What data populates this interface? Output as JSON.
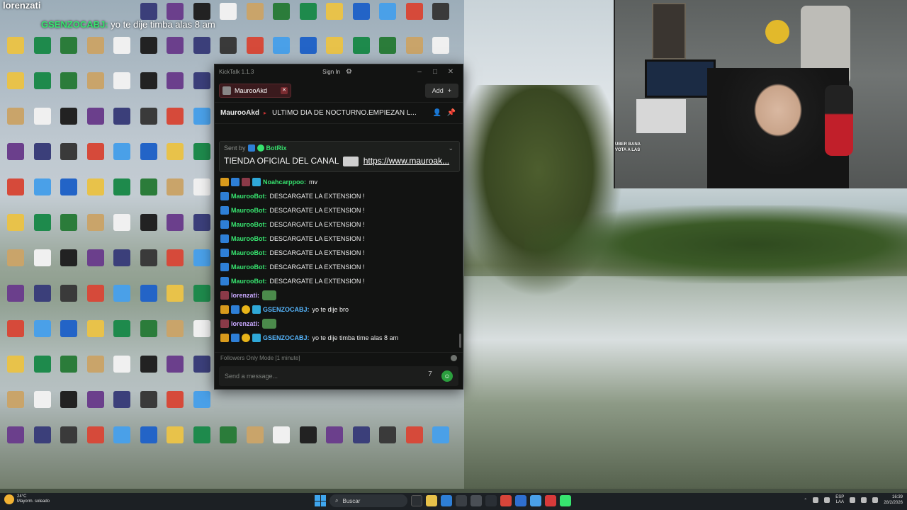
{
  "overlay": {
    "username1": "lorenzati",
    "user2": "GSENZOCABJ:",
    "message2": "yo te dije timba alas 8 am"
  },
  "desktop_icons": [
    {
      "label": "",
      "color": "#3b3f7a"
    },
    {
      "label": "",
      "color": "#2b7c3a"
    },
    {
      "label": "",
      "color": "#2364c7"
    },
    {
      "label": "",
      "color": "#6b3f8c"
    },
    {
      "label": "",
      "color": "#1e8a4c"
    },
    {
      "label": "",
      "color": "#2a5aa8"
    },
    {
      "label": "",
      "color": "#5fa33b"
    },
    {
      "label": "",
      "color": "#3c6b9b"
    },
    {
      "label": "",
      "color": "#f0f0f0"
    },
    {
      "label": "",
      "color": "#222"
    },
    {
      "label": "",
      "color": "#e8c24a"
    },
    {
      "label": "",
      "color": "#3a3a3a"
    },
    {
      "label": "",
      "color": "#e8c24a"
    },
    {
      "label": "",
      "color": "#f5f5f5"
    }
  ],
  "kicktalk": {
    "app_title": "KickTalk 1.1.3",
    "signin_label": "Sign In",
    "tab_label": "MaurooAkd",
    "add_label": "Add",
    "stream_name": "MaurooAkd",
    "stream_title": "ULTIMO DIA DE NOCTURNO.EMPIEZAN L...",
    "pinned": {
      "sent_by_label": "Sent by",
      "sender": "BotRix",
      "text": "TIENDA OFICIAL DEL CANAL",
      "link": "https://www.mauroak..."
    },
    "messages": [
      {
        "user": "Noahcarppoo:",
        "text": "mv",
        "color": "green",
        "badges": [
          "vip",
          "bot",
          "sub",
          "gem"
        ]
      },
      {
        "user": "MaurooBot:",
        "text": "DESCARGATE LA EXTENSION !",
        "color": "green",
        "badges": [
          "bot"
        ]
      },
      {
        "user": "MaurooBot:",
        "text": "DESCARGATE LA EXTENSION !",
        "color": "green",
        "badges": [
          "bot"
        ]
      },
      {
        "user": "MaurooBot:",
        "text": "DESCARGATE LA EXTENSION !",
        "color": "green",
        "badges": [
          "bot"
        ]
      },
      {
        "user": "MaurooBot:",
        "text": "DESCARGATE LA EXTENSION !",
        "color": "green",
        "badges": [
          "bot"
        ]
      },
      {
        "user": "MaurooBot:",
        "text": "DESCARGATE LA EXTENSION !",
        "color": "green",
        "badges": [
          "bot"
        ]
      },
      {
        "user": "MaurooBot:",
        "text": "DESCARGATE LA EXTENSION !",
        "color": "green",
        "badges": [
          "bot"
        ]
      },
      {
        "user": "MaurooBot:",
        "text": "DESCARGATE LA EXTENSION !",
        "color": "green",
        "badges": [
          "bot"
        ]
      },
      {
        "user": "lorenzati:",
        "text": "",
        "color": "purple",
        "badges": [
          "sub"
        ],
        "emote": true
      },
      {
        "user": "GSENZOCABJ:",
        "text": "yo te dije bro",
        "color": "blue",
        "badges": [
          "vip",
          "bot",
          "gift",
          "gem"
        ]
      },
      {
        "user": "lorenzati:",
        "text": "",
        "color": "purple",
        "badges": [
          "sub"
        ],
        "emote": true
      },
      {
        "user": "GSENZOCABJ:",
        "text": "yo te dije timba time alas 8 am",
        "color": "blue",
        "badges": [
          "vip",
          "bot",
          "gift",
          "gem"
        ]
      }
    ],
    "followers_mode": "Followers Only Mode [1 minute]",
    "input_placeholder": "Send a message..."
  },
  "cam_chat": {
    "line1": "UBER BANA",
    "line2": "VOTA A LAS"
  },
  "taskbar": {
    "weather_temp": "24°C",
    "weather_desc": "Mayorm. soleado",
    "search_label": "Buscar",
    "lang1": "ESP",
    "lang2": "LAA",
    "time": "16:39",
    "date": "28/2/2026"
  },
  "colors": {
    "kick_green": "#37e36f",
    "window_bg": "#121312",
    "tab_bg": "#3a1a1d"
  }
}
